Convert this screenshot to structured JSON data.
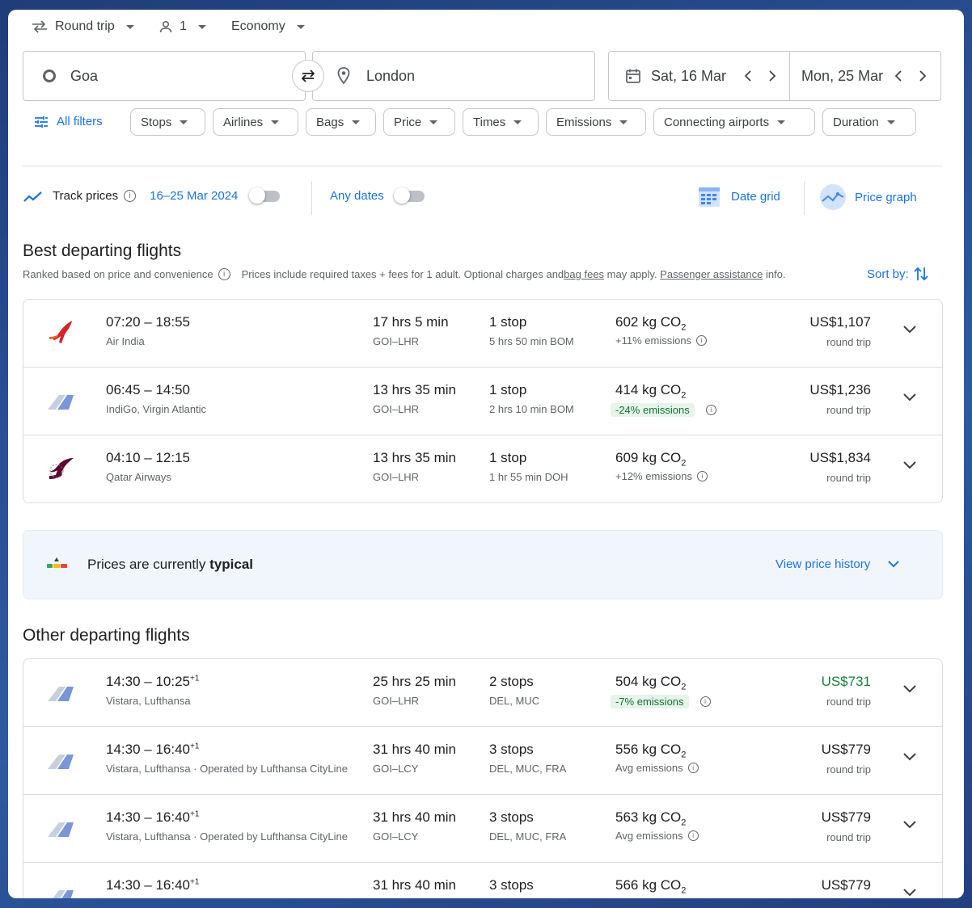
{
  "top": {
    "trip_type": "Round trip",
    "passengers": "1",
    "cabin": "Economy"
  },
  "search": {
    "origin": "Goa",
    "destination": "London",
    "depart_date": "Sat, 16 Mar",
    "return_date": "Mon, 25 Mar"
  },
  "filters": {
    "all_filters": "All filters",
    "chips": [
      "Stops",
      "Airlines",
      "Bags",
      "Price",
      "Times",
      "Emissions",
      "Connecting airports",
      "Duration"
    ]
  },
  "tracking": {
    "track_label": "Track prices",
    "date_range": "16–25 Mar 2024",
    "any_dates": "Any dates",
    "date_grid": "Date grid",
    "price_graph": "Price graph"
  },
  "best": {
    "title": "Best departing flights",
    "ranked": "Ranked based on price and convenience",
    "info_pre": "Prices include required taxes + fees for 1 adult. Optional charges and ",
    "bag_fees": "bag fees",
    "info_mid": " may apply. ",
    "passenger_assistance": "Passenger assistance",
    "info_post": " info.",
    "sort_by": "Sort by:",
    "flights": [
      {
        "time": "07:20 – 18:55",
        "plus": "",
        "airline": "Air India",
        "duration": "17 hrs 5 min",
        "route": "GOI–LHR",
        "stops": "1 stop",
        "stop_detail": "5 hrs 50 min BOM",
        "co2_value": "602 kg CO",
        "co2_sub": "2",
        "emissions": "+11% emissions",
        "price": "US$1,107",
        "price_type": "round trip",
        "logo": "air-india"
      },
      {
        "time": "06:45 – 14:50",
        "plus": "",
        "airline": "IndiGo, Virgin Atlantic",
        "duration": "13 hrs 35 min",
        "route": "GOI–LHR",
        "stops": "1 stop",
        "stop_detail": "2 hrs 10 min BOM",
        "co2_value": "414 kg CO",
        "co2_sub": "2",
        "emissions": "-24% emissions",
        "price": "US$1,236",
        "price_type": "round trip",
        "logo": "multi"
      },
      {
        "time": "04:10 – 12:15",
        "plus": "",
        "airline": "Qatar Airways",
        "duration": "13 hrs 35 min",
        "route": "GOI–LHR",
        "stops": "1 stop",
        "stop_detail": "1 hr 55 min DOH",
        "co2_value": "609 kg CO",
        "co2_sub": "2",
        "emissions": "+12% emissions",
        "price": "US$1,834",
        "price_type": "round trip",
        "logo": "qatar"
      }
    ]
  },
  "typical": {
    "text_pre": "Prices are currently ",
    "text_bold": "typical",
    "history": "View price history"
  },
  "other": {
    "title": "Other departing flights",
    "flights": [
      {
        "time": "14:30 – 10:25",
        "plus": "+1",
        "airline": "Vistara, Lufthansa",
        "duration": "25 hrs 25 min",
        "route": "GOI–LHR",
        "stops": "2 stops",
        "stop_detail": "DEL, MUC",
        "co2_value": "504 kg CO",
        "co2_sub": "2",
        "emissions": "-7% emissions",
        "price": "US$731",
        "price_type": "round trip"
      },
      {
        "time": "14:30 – 16:40",
        "plus": "+1",
        "airline": "Vistara, Lufthansa · Operated by Lufthansa CityLine",
        "duration": "31 hrs 40 min",
        "route": "GOI–LCY",
        "stops": "3 stops",
        "stop_detail": "DEL, MUC, FRA",
        "co2_value": "556 kg CO",
        "co2_sub": "2",
        "emissions": "Avg emissions",
        "price": "US$779",
        "price_type": "round trip"
      },
      {
        "time": "14:30 – 16:40",
        "plus": "+1",
        "airline": "Vistara, Lufthansa · Operated by Lufthansa CityLine",
        "duration": "31 hrs 40 min",
        "route": "GOI–LCY",
        "stops": "3 stops",
        "stop_detail": "DEL, MUC, FRA",
        "co2_value": "563 kg CO",
        "co2_sub": "2",
        "emissions": "Avg emissions",
        "price": "US$779",
        "price_type": "round trip"
      },
      {
        "time": "14:30 – 16:40",
        "plus": "+1",
        "duration": "31 hrs 40 min",
        "stops": "3 stops",
        "co2_value": "566 kg CO",
        "co2_sub": "2",
        "price": "US$779"
      }
    ]
  },
  "colors": {
    "accent": "#1a73e8",
    "good_green": "#188038",
    "border": "#dadce0"
  }
}
